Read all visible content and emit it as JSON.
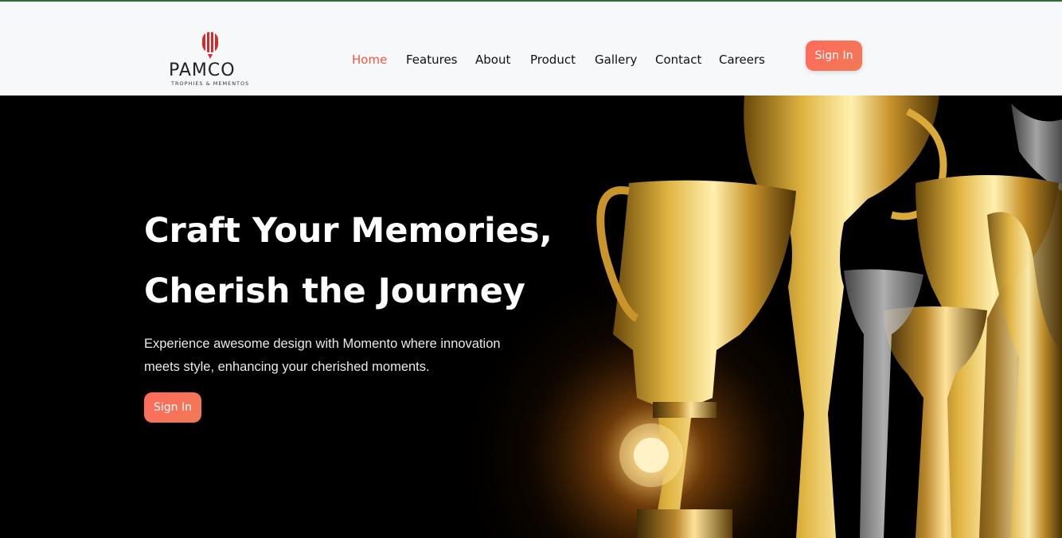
{
  "brand": {
    "logo_word": "PAMCO",
    "logo_tagline": "TROPHIES & MEMENTOS",
    "accent_color": "#ef5a3c"
  },
  "nav": {
    "items": [
      {
        "label": "Home",
        "active": true
      },
      {
        "label": "Features",
        "active": false
      },
      {
        "label": "About",
        "active": false
      },
      {
        "label": "Product",
        "active": false
      },
      {
        "label": "Gallery",
        "active": false
      },
      {
        "label": "Contact",
        "active": false
      },
      {
        "label": "Careers",
        "active": false
      }
    ],
    "signin_label": "Sign In"
  },
  "hero": {
    "title_line1": "Craft Your Memories,",
    "title_line2": "Cherish the Journey",
    "subtitle": "Experience awesome design with Momento where innovation meets style, enhancing your cherished moments.",
    "cta_label": "Sign In",
    "image": "golden-trophies"
  }
}
